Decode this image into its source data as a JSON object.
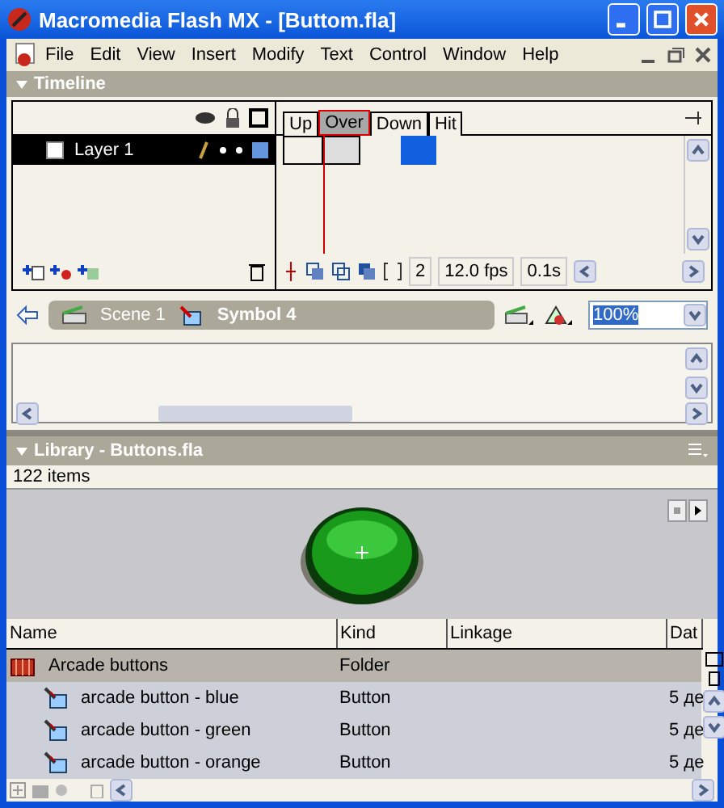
{
  "window": {
    "title": "Macromedia Flash MX - [Buttom.fla]"
  },
  "menu": [
    "File",
    "Edit",
    "View",
    "Insert",
    "Modify",
    "Text",
    "Control",
    "Window",
    "Help"
  ],
  "timeline": {
    "title": "Timeline",
    "layers": [
      {
        "name": "Layer 1",
        "selected": true
      }
    ],
    "frames": [
      {
        "label": "Up",
        "selected": false
      },
      {
        "label": "Over",
        "selected": true
      },
      {
        "label": "Down",
        "selected": false
      },
      {
        "label": "Hit",
        "selected": false
      }
    ],
    "current_frame": "2",
    "frame_rate": "12.0 fps",
    "elapsed": "0.1s"
  },
  "edit_bar": {
    "scene": "Scene 1",
    "symbol": "Symbol 4",
    "zoom": "100%"
  },
  "library": {
    "title": "Library - Buttons.fla",
    "count": "122 items",
    "columns": [
      "Name",
      "Kind",
      "Linkage",
      "Dat"
    ],
    "rows": [
      {
        "kind": "folder",
        "name": "Arcade buttons",
        "type": "Folder",
        "selected": true
      },
      {
        "kind": "button",
        "name": "arcade button - blue",
        "type": "Button",
        "date": "5 де",
        "selected": false
      },
      {
        "kind": "button",
        "name": "arcade button - green",
        "type": "Button",
        "date": "5 де",
        "selected": false
      },
      {
        "kind": "button",
        "name": "arcade button - orange",
        "type": "Button",
        "date": "5 де",
        "selected": false
      }
    ]
  }
}
